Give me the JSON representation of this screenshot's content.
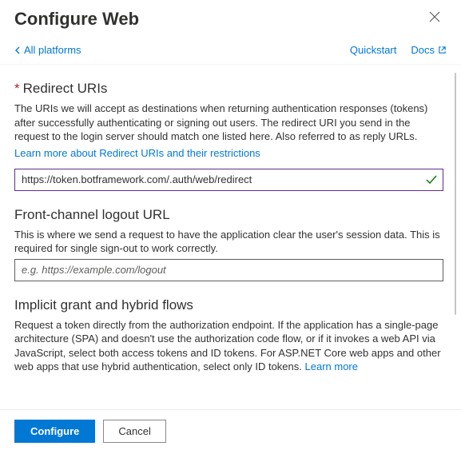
{
  "header": {
    "title": "Configure Web"
  },
  "topnav": {
    "back": "All platforms",
    "quickstart": "Quickstart",
    "docs": "Docs"
  },
  "sections": {
    "redirect": {
      "title": "Redirect URIs",
      "desc": "The URIs we will accept as destinations when returning authentication responses (tokens) after successfully authenticating or signing out users. The redirect URI you send in the request to the login server should match one listed here. Also referred to as reply URLs.",
      "learn": "Learn more about Redirect URIs and their restrictions",
      "value": "https://token.botframework.com/.auth/web/redirect"
    },
    "logout": {
      "title": "Front-channel logout URL",
      "desc": "This is where we send a request to have the application clear the user's session data. This is required for single sign-out to work correctly.",
      "placeholder": "e.g. https://example.com/logout"
    },
    "implicit": {
      "title": "Implicit grant and hybrid flows",
      "desc": "Request a token directly from the authorization endpoint. If the application has a single-page architecture (SPA) and doesn't use the authorization code flow, or if it invokes a web API via JavaScript, select both access tokens and ID tokens. For ASP.NET Core web apps and other web apps that use hybrid authentication, select only ID tokens. ",
      "learn": "Learn more"
    }
  },
  "footer": {
    "configure": "Configure",
    "cancel": "Cancel"
  }
}
